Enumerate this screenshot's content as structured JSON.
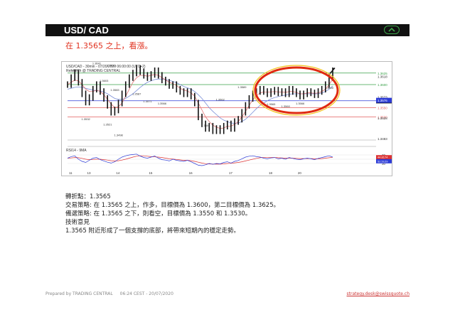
{
  "header": {
    "title": "USD/ CAD"
  },
  "headline": "在 1.3565 之上，看漲。",
  "chart": {
    "title_line1": "USD/CAD - 30min - 07/20/2020 06:00:00 (UTC+2)",
    "title_line2": "Research @ TRADING CENTRAL",
    "price_ticks": [
      "1.3618",
      "1.3573",
      "1.3528",
      "1.3483"
    ],
    "level_labels": [
      "1.3625",
      "1.3600",
      "1.3565",
      "1.3550",
      "1.3530"
    ],
    "last_price_label": "1.35641",
    "last_price_sub": "1.3576",
    "annotations": [
      "1.3627",
      "1.3662",
      "1.3641",
      "1.3603",
      "1.3636",
      "1.3583",
      "1.3587",
      "1.3571",
      "1.3566",
      "1.3532",
      "1.3521",
      "1.3498",
      "1.3506",
      "1.3562",
      "1.3589",
      "1.3565",
      "1.3560",
      "1.3566",
      "1.3600"
    ],
    "rsi_title": "RSI14 - 9MA",
    "rsi_ticks": [
      "70",
      "50",
      "30"
    ],
    "rsi_badge_1": "44.8174",
    "rsi_badge_2": "52.5129",
    "date_labels": [
      "11",
      "13",
      "14",
      "15",
      "16",
      "17",
      "18",
      "20"
    ],
    "series": {
      "close": [
        1.36,
        1.3615,
        1.3625,
        1.3605,
        1.358,
        1.3562,
        1.3572,
        1.359,
        1.36,
        1.3585,
        1.357,
        1.3555,
        1.354,
        1.3545,
        1.356,
        1.358,
        1.36,
        1.3615,
        1.3625,
        1.3635,
        1.3628,
        1.362,
        1.3615,
        1.3622,
        1.363,
        1.362,
        1.361,
        1.3605,
        1.3598,
        1.36,
        1.359,
        1.3585,
        1.358,
        1.3585,
        1.3575,
        1.356,
        1.353,
        1.3515,
        1.3505,
        1.351,
        1.35,
        1.3505,
        1.35,
        1.351,
        1.3515,
        1.3505,
        1.352,
        1.3525,
        1.354,
        1.3555,
        1.357,
        1.358,
        1.3585,
        1.359,
        1.3585,
        1.358,
        1.3585,
        1.3588,
        1.3582,
        1.3585,
        1.358,
        1.359,
        1.3585,
        1.358,
        1.3575,
        1.358,
        1.3585,
        1.3582,
        1.3578,
        1.3585,
        1.359,
        1.36,
        1.3615,
        1.363
      ],
      "ma_fast": [
        1.36,
        1.3605,
        1.361,
        1.3608,
        1.36,
        1.359,
        1.3585,
        1.3585,
        1.3588,
        1.3585,
        1.3578,
        1.3568,
        1.3558,
        1.355,
        1.3552,
        1.356,
        1.3575,
        1.359,
        1.3605,
        1.3615,
        1.362,
        1.362,
        1.3618,
        1.362,
        1.3622,
        1.362,
        1.3615,
        1.361,
        1.3605,
        1.3602,
        1.3598,
        1.3592,
        1.3588,
        1.3586,
        1.3582,
        1.3575,
        1.356,
        1.3545,
        1.353,
        1.352,
        1.3512,
        1.3508,
        1.3505,
        1.3506,
        1.351,
        1.351,
        1.3514,
        1.352,
        1.353,
        1.3542,
        1.3555,
        1.3567,
        1.3576,
        1.3582,
        1.3584,
        1.3584,
        1.3584,
        1.3585,
        1.3584,
        1.3584,
        1.3583,
        1.3585,
        1.3585,
        1.3583,
        1.358,
        1.358,
        1.3582,
        1.3582,
        1.3581,
        1.3582,
        1.3585,
        1.359,
        1.36,
        1.3612
      ],
      "ma_slow": [
        1.359,
        1.3592,
        1.3594,
        1.3595,
        1.3594,
        1.3592,
        1.359,
        1.3588,
        1.3587,
        1.3586,
        1.3584,
        1.358,
        1.3575,
        1.357,
        1.3568,
        1.3568,
        1.357,
        1.3575,
        1.358,
        1.3587,
        1.3594,
        1.36,
        1.3605,
        1.3608,
        1.3611,
        1.3612,
        1.3612,
        1.3611,
        1.3609,
        1.3607,
        1.3604,
        1.36,
        1.3596,
        1.3593,
        1.359,
        1.3585,
        1.3578,
        1.357,
        1.356,
        1.355,
        1.3542,
        1.3535,
        1.3528,
        1.3523,
        1.352,
        1.3517,
        1.3516,
        1.3517,
        1.352,
        1.3525,
        1.3532,
        1.354,
        1.3548,
        1.3555,
        1.356,
        1.3565,
        1.3569,
        1.3572,
        1.3574,
        1.3576,
        1.3577,
        1.3579,
        1.358,
        1.358,
        1.358,
        1.358,
        1.358,
        1.358,
        1.358,
        1.358,
        1.3582,
        1.3585,
        1.359,
        1.3597
      ],
      "rsi": [
        55,
        62,
        66,
        50,
        40,
        35,
        45,
        55,
        58,
        48,
        42,
        36,
        32,
        38,
        50,
        60,
        66,
        70,
        72,
        74,
        65,
        58,
        55,
        60,
        65,
        55,
        48,
        46,
        42,
        50,
        45,
        42,
        40,
        45,
        38,
        30,
        22,
        20,
        24,
        30,
        26,
        30,
        28,
        35,
        38,
        32,
        40,
        44,
        52,
        60,
        64,
        66,
        62,
        60,
        55,
        52,
        56,
        58,
        52,
        55,
        50,
        58,
        54,
        50,
        48,
        52,
        55,
        52,
        48,
        54,
        58,
        62,
        66,
        60
      ],
      "rsi_ma": [
        55,
        56,
        58,
        57,
        54,
        50,
        48,
        49,
        50,
        50,
        48,
        46,
        43,
        42,
        43,
        46,
        50,
        55,
        60,
        64,
        66,
        66,
        64,
        62,
        61,
        60,
        58,
        55,
        52,
        51,
        49,
        47,
        45,
        45,
        43,
        40,
        36,
        32,
        29,
        28,
        27,
        27,
        27,
        28,
        30,
        31,
        33,
        35,
        38,
        42,
        46,
        50,
        54,
        57,
        59,
        59,
        59,
        58,
        57,
        56,
        55,
        55,
        55,
        54,
        53,
        53,
        53,
        53,
        52,
        52,
        53,
        55,
        57,
        59
      ]
    }
  },
  "analysis": {
    "pivot": "轉折點：1.3565",
    "strategy": "交易策略: 在 1.3565 之上，作多，目標價為 1.3600，第二目標價為 1.3625。",
    "alternative": "備選策略: 在 1.3565 之下，則看空，目標價為 1.3550 和 1.3530。",
    "comment_title": "技術意見",
    "comment": "1.3565 附近形成了一個支撐的底部，將帶來短期內的穩定走勢。"
  },
  "footer": {
    "prepared": "Prepared by TRADING CENTRAL",
    "timestamp": "06:24 CEST - 20/07/2020",
    "email": "strategy.desk@swissquote.ch"
  },
  "colors": {
    "headline": "#e0301e",
    "support": "#2d3bd6",
    "resistance": "#e35d5d",
    "target": "#3aa14a",
    "ellipse": "#e02a10"
  }
}
